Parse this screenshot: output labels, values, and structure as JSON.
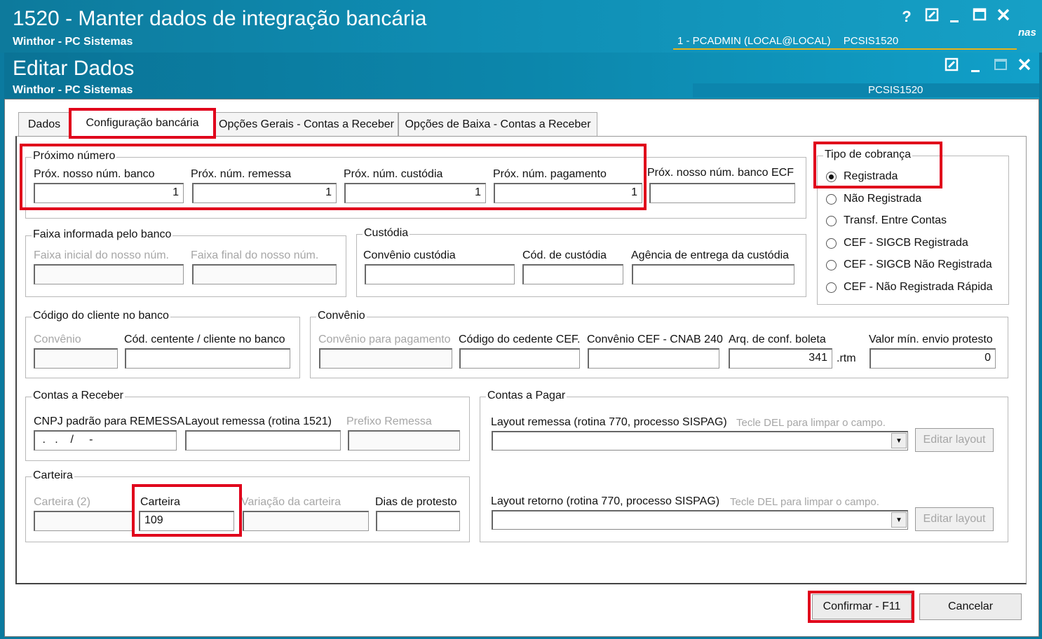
{
  "outer_window": {
    "title": "1520 - Manter dados de integração bancária",
    "subtitle": "Winthor - PC Sistemas",
    "user_info": "1 - PCADMIN (LOCAL@LOCAL)",
    "routine_code": "PCSIS1520",
    "brand_fragment": "nas",
    "help_label": "?"
  },
  "inner_window": {
    "title": "Editar Dados",
    "subtitle": "Winthor - PC Sistemas",
    "routine_code": "PCSIS1520"
  },
  "tabs": [
    {
      "label": "Dados"
    },
    {
      "label": "Configuração bancária"
    },
    {
      "label": "Opções Gerais - Contas a Receber"
    },
    {
      "label": "Opções de Baixa - Contas a Receber"
    }
  ],
  "proximo_numero": {
    "title": "Próximo número",
    "fields": [
      {
        "label": "Próx. nosso núm. banco",
        "value": "1"
      },
      {
        "label": "Próx. núm. remessa",
        "value": "1"
      },
      {
        "label": "Próx. núm. custódia",
        "value": "1"
      },
      {
        "label": "Próx. núm. pagamento",
        "value": "1"
      },
      {
        "label": "Próx. nosso núm. banco ECF",
        "value": ""
      }
    ]
  },
  "tipo_cobranca": {
    "title": "Tipo de cobrança",
    "options": [
      "Registrada",
      "Não Registrada",
      "Transf. Entre Contas",
      "CEF - SIGCB Registrada",
      "CEF - SIGCB Não Registrada",
      "CEF - Não Registrada Rápida"
    ],
    "selected": "Registrada"
  },
  "faixa": {
    "title": "Faixa informada pelo banco",
    "inicial_label": "Faixa inicial do nosso núm.",
    "final_label": "Faixa final do nosso núm."
  },
  "custodia": {
    "title": "Custódia",
    "convenio_label": "Convênio custódia",
    "codigo_label": "Cód. de custódia",
    "agencia_label": "Agência de entrega da custódia"
  },
  "codigo_cliente": {
    "title": "Código do cliente no banco",
    "convenio_label": "Convênio",
    "cedente_label": "Cód. centente / cliente no banco"
  },
  "convenio": {
    "title": "Convênio",
    "pagamento_label": "Convênio para pagamento",
    "cedente_cef_label": "Código do cedente CEF.",
    "cnab_label": "Convênio CEF - CNAB 240",
    "arq_label": "Arq. de conf. boleta",
    "arq_value": "341",
    "arq_ext": ".rtm",
    "valor_min_label": "Valor mín. envio protesto",
    "valor_min_value": "0"
  },
  "contas_receber": {
    "title": "Contas a Receber",
    "cnpj_label": "CNPJ padrão para REMESSA",
    "cnpj_mask": " .   .    /     -",
    "layout_label": "Layout remessa (rotina 1521)",
    "prefixo_label": "Prefixo Remessa"
  },
  "carteira": {
    "title": "Carteira",
    "carteira2_label": "Carteira (2)",
    "carteira_label": "Carteira",
    "carteira_value": "109",
    "variacao_label": "Variação da carteira",
    "dias_label": "Dias de protesto"
  },
  "contas_pagar": {
    "title": "Contas a Pagar",
    "remessa_label": "Layout remessa (rotina 770, processo SISPAG)",
    "remessa_hint": "Tecle DEL para limpar o campo.",
    "retorno_label": "Layout retorno (rotina 770, processo SISPAG)",
    "retorno_hint": "Tecle DEL para limpar o campo.",
    "editar_label": "Editar layout"
  },
  "footer": {
    "confirmar_label": "Confirmar - F11",
    "cancelar_label": "Cancelar"
  },
  "colors": {
    "titlebar": "#0f8db3",
    "highlight": "#e0001b"
  }
}
